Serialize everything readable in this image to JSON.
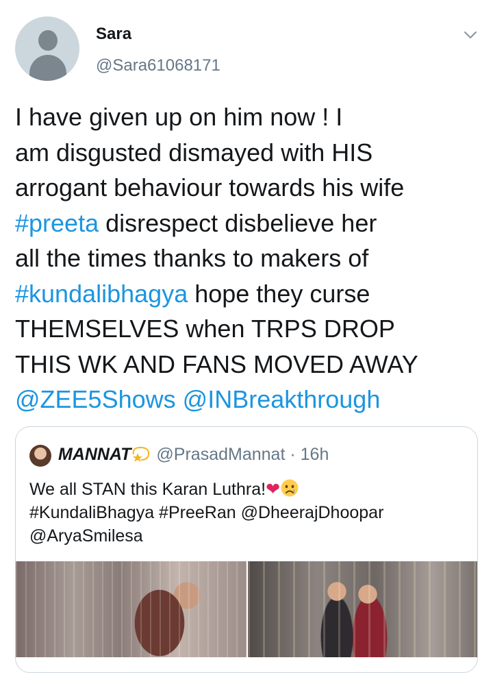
{
  "tweet": {
    "author": {
      "display_name": "Sara",
      "handle": "@Sara61068171"
    },
    "menu_icon": "chevron-down-icon",
    "body_lines": [
      [
        {
          "text": "I have given up on him now !  I",
          "link": false
        }
      ],
      [
        {
          "text": "am disgusted dismayed with HIS",
          "link": false
        }
      ],
      [
        {
          "text": "arrogant behaviour towards his wife",
          "link": false
        }
      ],
      [
        {
          "text": "#preeta",
          "link": true
        },
        {
          "text": " disrespect disbelieve her",
          "link": false
        }
      ],
      [
        {
          "text": "all the times thanks to makers of",
          "link": false
        }
      ],
      [
        {
          "text": "#kundalibhagya",
          "link": true
        },
        {
          "text": " hope they curse",
          "link": false
        }
      ],
      [
        {
          "text": "THEMSELVES when TRPS DROP",
          "link": false
        }
      ],
      [
        {
          "text": "THIS WK AND FANS MOVED AWAY",
          "link": false
        }
      ],
      [
        {
          "text": "@ZEE5Shows",
          "link": true
        },
        {
          "text": " ",
          "link": false
        },
        {
          "text": "@INBreakthrough",
          "link": true
        }
      ]
    ]
  },
  "quoted_tweet": {
    "display_name": "MANNAT",
    "name_emoji_icon": "star-badge-icon",
    "handle": "@PrasadMannat",
    "separator": "·",
    "time": "16h",
    "body_line_1": "We all STAN this Karan Luthra!",
    "body_line_1_emojis": [
      "red-heart-icon",
      "crying-face-icon"
    ],
    "body_line_2": "#KundaliBhagya #PreeRan @DheerajDhoopar",
    "body_line_3": "@AryaSmilesa",
    "media": [
      "video-still-left",
      "video-still-right"
    ]
  },
  "colors": {
    "text": "#14171a",
    "secondary": "#657786",
    "link": "#1b95e0",
    "border": "#ccd6dd"
  }
}
